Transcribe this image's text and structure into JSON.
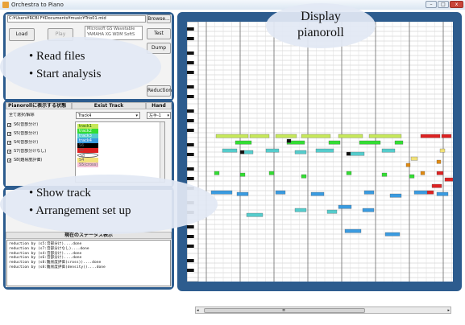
{
  "window": {
    "title": "Orchestra to Piano",
    "min_symbol": "–",
    "max_symbol": "□",
    "close_symbol": "x"
  },
  "file": {
    "path": "C:¥Users¥RCBI F¥Documents¥music¥Trio01.mid",
    "browse_label": "Browse..."
  },
  "buttons": {
    "load": "Load",
    "play": "Play",
    "test": "Test",
    "dump": "Dump",
    "reduction": "Reduction"
  },
  "device": {
    "line1": "Microsoft GS Wavetable",
    "line2": "YAMAHA XG WDM SoftS"
  },
  "table": {
    "header_left": "Pianorollに表示する状態",
    "header_exist": "Exist Track",
    "header_hand": "Hand",
    "select_all": "全て選択/解除",
    "track_select": "Track4",
    "hand_select": "左手-1",
    "states": [
      "S6(音部分け)",
      "S5(音部分け)",
      "S4(音部分け)",
      "S7(音部分けなし)",
      "S8(難易度評価)"
    ],
    "tracks": [
      {
        "label": "track1",
        "color": "#c6e85a",
        "text_color": "#1a5a00"
      },
      {
        "label": "track2",
        "color": "#33dd33",
        "text_color": "#ffffff"
      },
      {
        "label": "track3",
        "color": "#55cccc",
        "text_color": "#ffffff"
      },
      {
        "label": "track4",
        "color": "#3a9be0",
        "text_color": "#ffffff"
      },
      {
        "label": "S6",
        "color": "#000000",
        "text_color": "#666666"
      },
      {
        "label": "S7",
        "color": "#dd2222",
        "text_color": "#666666"
      },
      {
        "label": "S8",
        "color": "#ffffff",
        "text_color": "#666666"
      },
      {
        "label": "S4",
        "color": "#f1e27a",
        "text_color": "#666666"
      },
      {
        "label": "S5(cross)",
        "color": "#f3c1d6",
        "text_color": "#666666"
      }
    ]
  },
  "status": {
    "header": "現在のステータス表示",
    "lines": [
      "reduction by (s5:音部分け)....done",
      "reduction by (s7:音部分けなし)....done",
      "reduction by (s4:音部分け)....done",
      "reduction by (s6:音部分け)....done",
      "reduction by (s8:難易度評価(cross))....done",
      "reduction by (s8:難易度評価(density))....done"
    ]
  },
  "callouts": {
    "display": "Display",
    "pianoroll": "pianoroll",
    "read_files": "Read files",
    "start_analysis": "Start analysis",
    "show_track": "Show track",
    "arrangement": "Arrangement set up",
    "bullet": "•"
  },
  "scrollbar": {
    "left_arrow": "◂",
    "right_arrow": "▸",
    "thumb_mark": "≡"
  },
  "colors": {
    "frame": "#2d5c8e",
    "grid": "#c4c4c4",
    "bar_line": "#7a7a7a"
  },
  "notes": [
    {
      "kind": "olive",
      "color": "#c6e85a"
    },
    {
      "kind": "green",
      "color": "#33dd33"
    },
    {
      "kind": "teal",
      "color": "#55cccc"
    },
    {
      "kind": "blue",
      "color": "#3a9be0"
    },
    {
      "kind": "black",
      "color": "#111111"
    },
    {
      "kind": "red",
      "color": "#dd2222"
    },
    {
      "kind": "orange",
      "color": "#e08a10"
    },
    {
      "kind": "yellow",
      "color": "#f1e27a"
    }
  ]
}
